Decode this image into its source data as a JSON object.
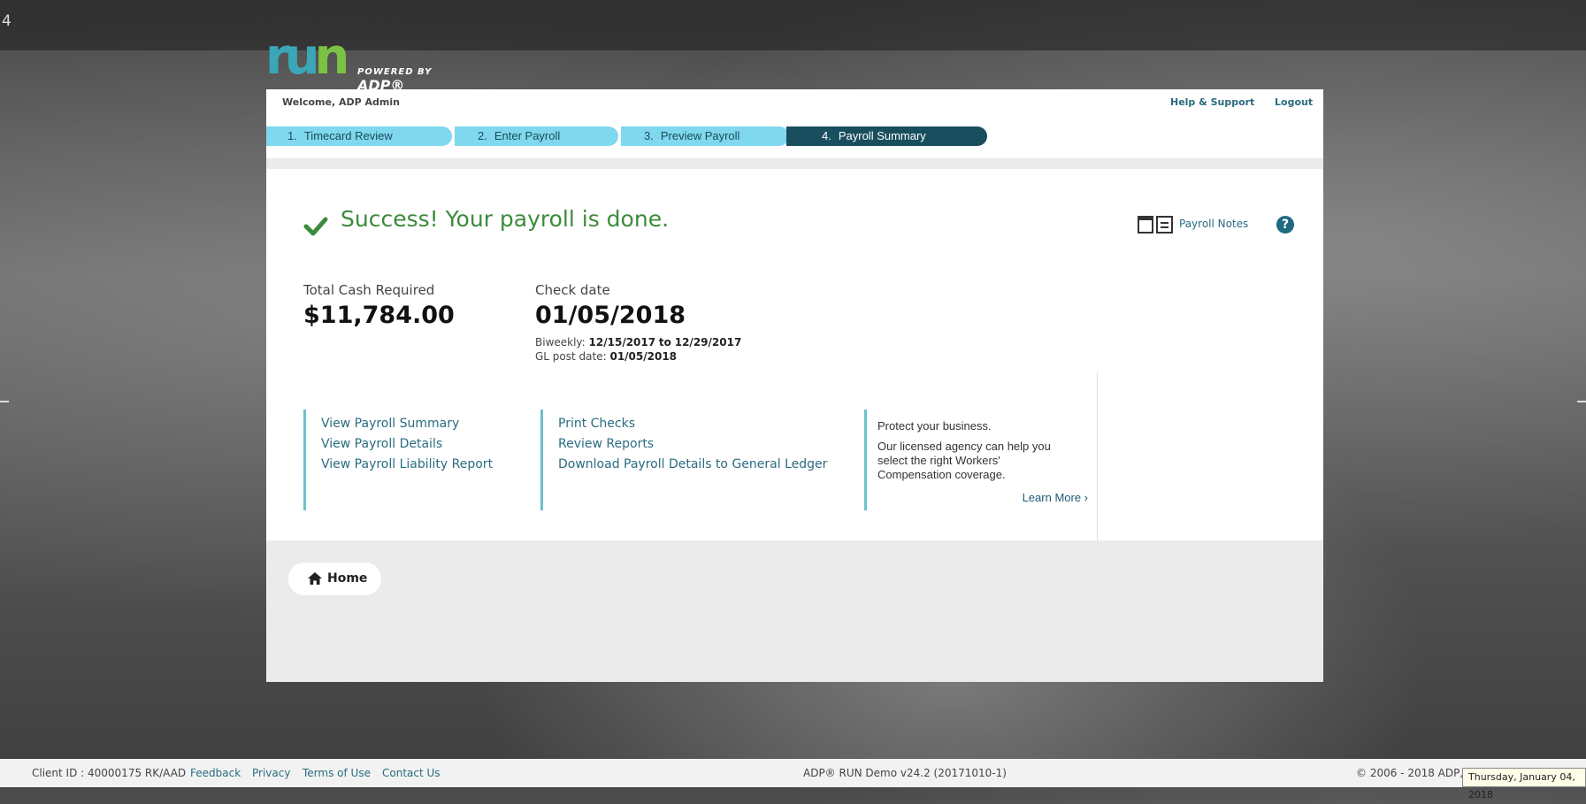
{
  "edge": {
    "number": "4"
  },
  "logo": {
    "run_ru": "ru",
    "run_n": "n",
    "powered_by": "POWERED BY",
    "adp": "ADP®"
  },
  "header": {
    "welcome": "Welcome, ADP Admin",
    "help": "Help & Support",
    "logout": "Logout"
  },
  "steps": [
    {
      "num": "1.",
      "label": "Timecard Review"
    },
    {
      "num": "2.",
      "label": "Enter Payroll"
    },
    {
      "num": "3.",
      "label": "Preview Payroll"
    },
    {
      "num": "4.",
      "label": "Payroll Summary",
      "active": true
    }
  ],
  "success": {
    "message": "Success! Your payroll is done."
  },
  "notes": {
    "label": "Payroll Notes"
  },
  "help_icon": "question-circle-icon",
  "summary": {
    "cash_label": "Total Cash Required",
    "cash_value": "$11,784.00",
    "check_label": "Check date",
    "check_value": "01/05/2018",
    "period_label": "Biweekly:",
    "period_start": "12/15/2017",
    "period_to": "to",
    "period_end": "12/29/2017",
    "gl_label": "GL post date:",
    "gl_value": "01/05/2018"
  },
  "links": {
    "col1": [
      "View Payroll Summary",
      "View Payroll Details",
      "View Payroll Liability Report"
    ],
    "col2": [
      "Print Checks",
      "Review Reports",
      "Download Payroll Details to General Ledger"
    ]
  },
  "promo": {
    "title": "Protect your business.",
    "body": "Our licensed agency can help you select the right Workers' Compensation coverage.",
    "learn_more": "Learn More ›"
  },
  "home": {
    "label": "Home"
  },
  "footer": {
    "client_id": "Client ID : 40000175 RK/AAD",
    "feedback": "Feedback",
    "privacy": "Privacy",
    "terms": "Terms of Use",
    "contact": "Contact Us",
    "version": "ADP® RUN Demo v24.2 (20171010-1)",
    "copyright": "© 2006 - 2018 ADP, L"
  },
  "tooltip": {
    "text": "Thursday, January 04, 2018"
  },
  "colors": {
    "accent": "#7fd8ee",
    "active_step": "#184e5e",
    "success": "#3c8b3c",
    "link": "#2a6c80"
  }
}
